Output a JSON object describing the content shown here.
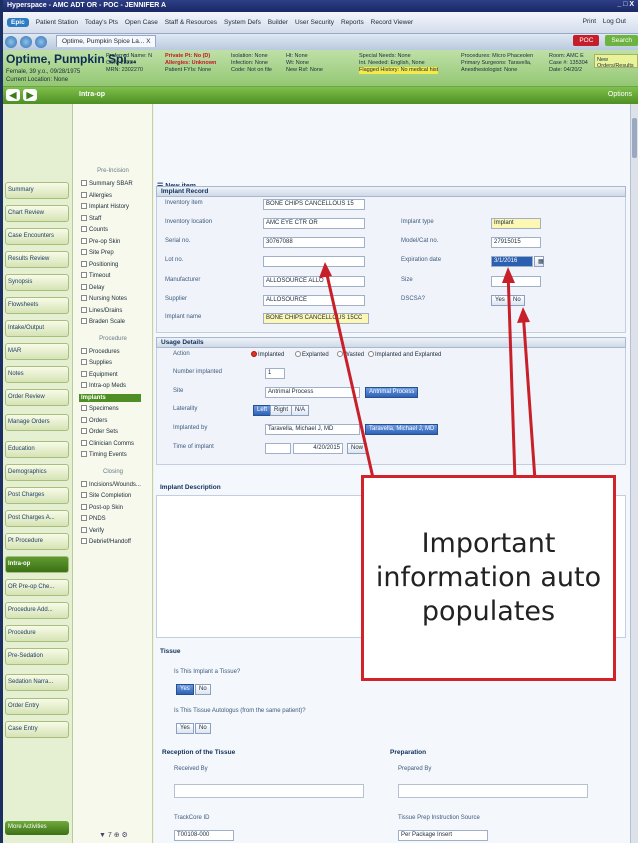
{
  "window": {
    "title": "Hyperspace - AMC ADT OR - POC - JENNIFER A",
    "controls": "_ □ X"
  },
  "menubar": {
    "logo": "Epic",
    "items": [
      "Patient Station",
      "Today's Pts",
      "Open Case",
      "Staff & Resources",
      "System Defs",
      "Builder",
      "User Security",
      "Reports",
      "Record Viewer"
    ],
    "right_items": [
      "Print",
      "Log Out"
    ]
  },
  "tabbar": {
    "patient_tab": "Optime, Pumpkin Spice La...",
    "close": "X",
    "chip_red": "POC",
    "search": "Search"
  },
  "banner": {
    "name": "Optime, Pumpkin Spi...",
    "info": "Female, 39 y.o., 09/28/1975",
    "location": "Current Location: None",
    "cols": [
      [
        "Preferred Name: N",
        "CSN: 28284",
        "MRN: 2302270"
      ],
      [
        "Private Pt: No (D)",
        "Allergies: Unknown",
        "Patient FYIs: None"
      ],
      [
        "Isolation: None",
        "Infection: None",
        "Code: Not on file"
      ],
      [
        "Ht: None",
        "Wt: None",
        "New Rsf: None"
      ],
      [
        "Special Needs: None",
        "Int. Needed: English, None",
        "Flagged History: No medical hist"
      ],
      [
        "Procedures: Micro Phaceolen",
        "Primary Surgeons: Taravella,",
        "Anesthesiologist: None"
      ],
      [
        "Room: AMC E",
        "Case #: 135304",
        "Date: 04/20/2"
      ]
    ],
    "new_orders": "New Orders/Results"
  },
  "activity": {
    "title": "Intra-op",
    "help": "Options"
  },
  "left_nav": [
    "Summary",
    "Chart Review",
    "Case Encounters",
    "Results Review",
    "Synopsis",
    "Flowsheets",
    "Intake/Output",
    "MAR",
    "Notes",
    "Order Review",
    "Manage Orders",
    "Education",
    "Demographics",
    "Post Charges",
    "Post Charges A...",
    "Pt Procedure",
    "Intra-op",
    "OR Pre-op Che...",
    "Procedure Add...",
    "Procedure",
    "Pre-Sedation",
    "Sedation Narra...",
    "Order Entry",
    "Case Entry"
  ],
  "left_nav_active": "Intra-op",
  "more_activities": "More Activities",
  "phases": {
    "preincision_header": "Pre-Incision",
    "preincision": [
      "Summary SBAR",
      "Allergies",
      "Implant History",
      "Staff",
      "Counts",
      "Pre-op Skin",
      "Site Prep",
      "Positioning",
      "Timeout",
      "Delay",
      "Nursing Notes",
      "Lines/Drains",
      "Braden Scale"
    ],
    "procedure_header": "Procedure",
    "procedure": [
      "Procedures",
      "Supplies",
      "Equipment",
      "Intra-op Meds",
      "Implants",
      "Specimens",
      "Orders",
      "Order Sets",
      "Clinician Comms",
      "Timing Events"
    ],
    "closing_header": "Closing",
    "closing": [
      "Incisions/Wounds...",
      "Site Completion",
      "Post-op Skin",
      "PNDS",
      "Verify",
      "Debrief/Handoff"
    ],
    "active": "Implants",
    "pager": "▼ 7 ⊕ ⚙"
  },
  "form": {
    "new_item": "New item",
    "implant_record": {
      "header": "Implant Record",
      "inventory_item_label": "Inventory item",
      "inventory_item": "BONE CHIPS CANCELLOUS 15",
      "inventory_location_label": "Inventory location",
      "inventory_location": "AMC EYE CTR OR",
      "serial_label": "Serial no.",
      "serial": "30767088",
      "lot_label": "Lot no.",
      "lot": "",
      "manufacturer_label": "Manufacturer",
      "manufacturer": "ALLOSOURCE ALLO",
      "supplier_label": "Supplier",
      "supplier": "ALLOSOURCE",
      "implant_name_label": "Implant name",
      "implant_name": "BONE CHIPS CANCELLOUS 15CC",
      "implant_type_label": "Implant type",
      "implant_type": "Implant",
      "model_label": "Model/Cat no.",
      "model": "27915015",
      "expiration_label": "Expiration date",
      "expiration": "3/1/2016",
      "size_label": "Size",
      "size": "",
      "dscsa_label": "DSCSA?",
      "dscsa_yes": "Yes",
      "dscsa_no": "No"
    },
    "usage_details": {
      "header": "Usage Details",
      "action_label": "Action",
      "actions": [
        "Implanted",
        "Explanted",
        "Wasted",
        "Implanted and Explanted"
      ],
      "number_label": "Number implanted",
      "number": "1",
      "site_label": "Site",
      "site": "Antrimal Process",
      "site_button": "Antrimal Process",
      "laterality_label": "Laterality",
      "laterality": [
        "Left",
        "Right",
        "N/A"
      ],
      "implanted_by_label": "Implanted by",
      "implanted_by": "Taravella, Michael J, MD",
      "implanted_by_button": "Taravella, Michael J, MD",
      "time_label": "Time of implant",
      "time_date": "4/20/2015",
      "now": "Now"
    },
    "implant_description": "Implant Description",
    "tissue": {
      "header": "Tissue",
      "q1": "Is This Implant a Tissue?",
      "q1_yes": "Yes",
      "q1_no": "No",
      "q2": "Is This Tissue Autologus (from the same patient)?",
      "q2_yes": "Yes",
      "q2_no": "No"
    },
    "reception": {
      "header": "Reception of the Tissue",
      "received_by": "Received By",
      "trackcore": "TrackCore ID",
      "trackcore_value": "T00108-000"
    },
    "preparation": {
      "header": "Preparation",
      "prepared_by": "Prepared By",
      "instruction": "Tissue Prep Instruction Source",
      "instruction_value": "Per Package Insert"
    }
  },
  "callout": {
    "text": "Important information auto populates",
    "border_color": "#d2232a",
    "arrow_color": "#c8202a"
  }
}
